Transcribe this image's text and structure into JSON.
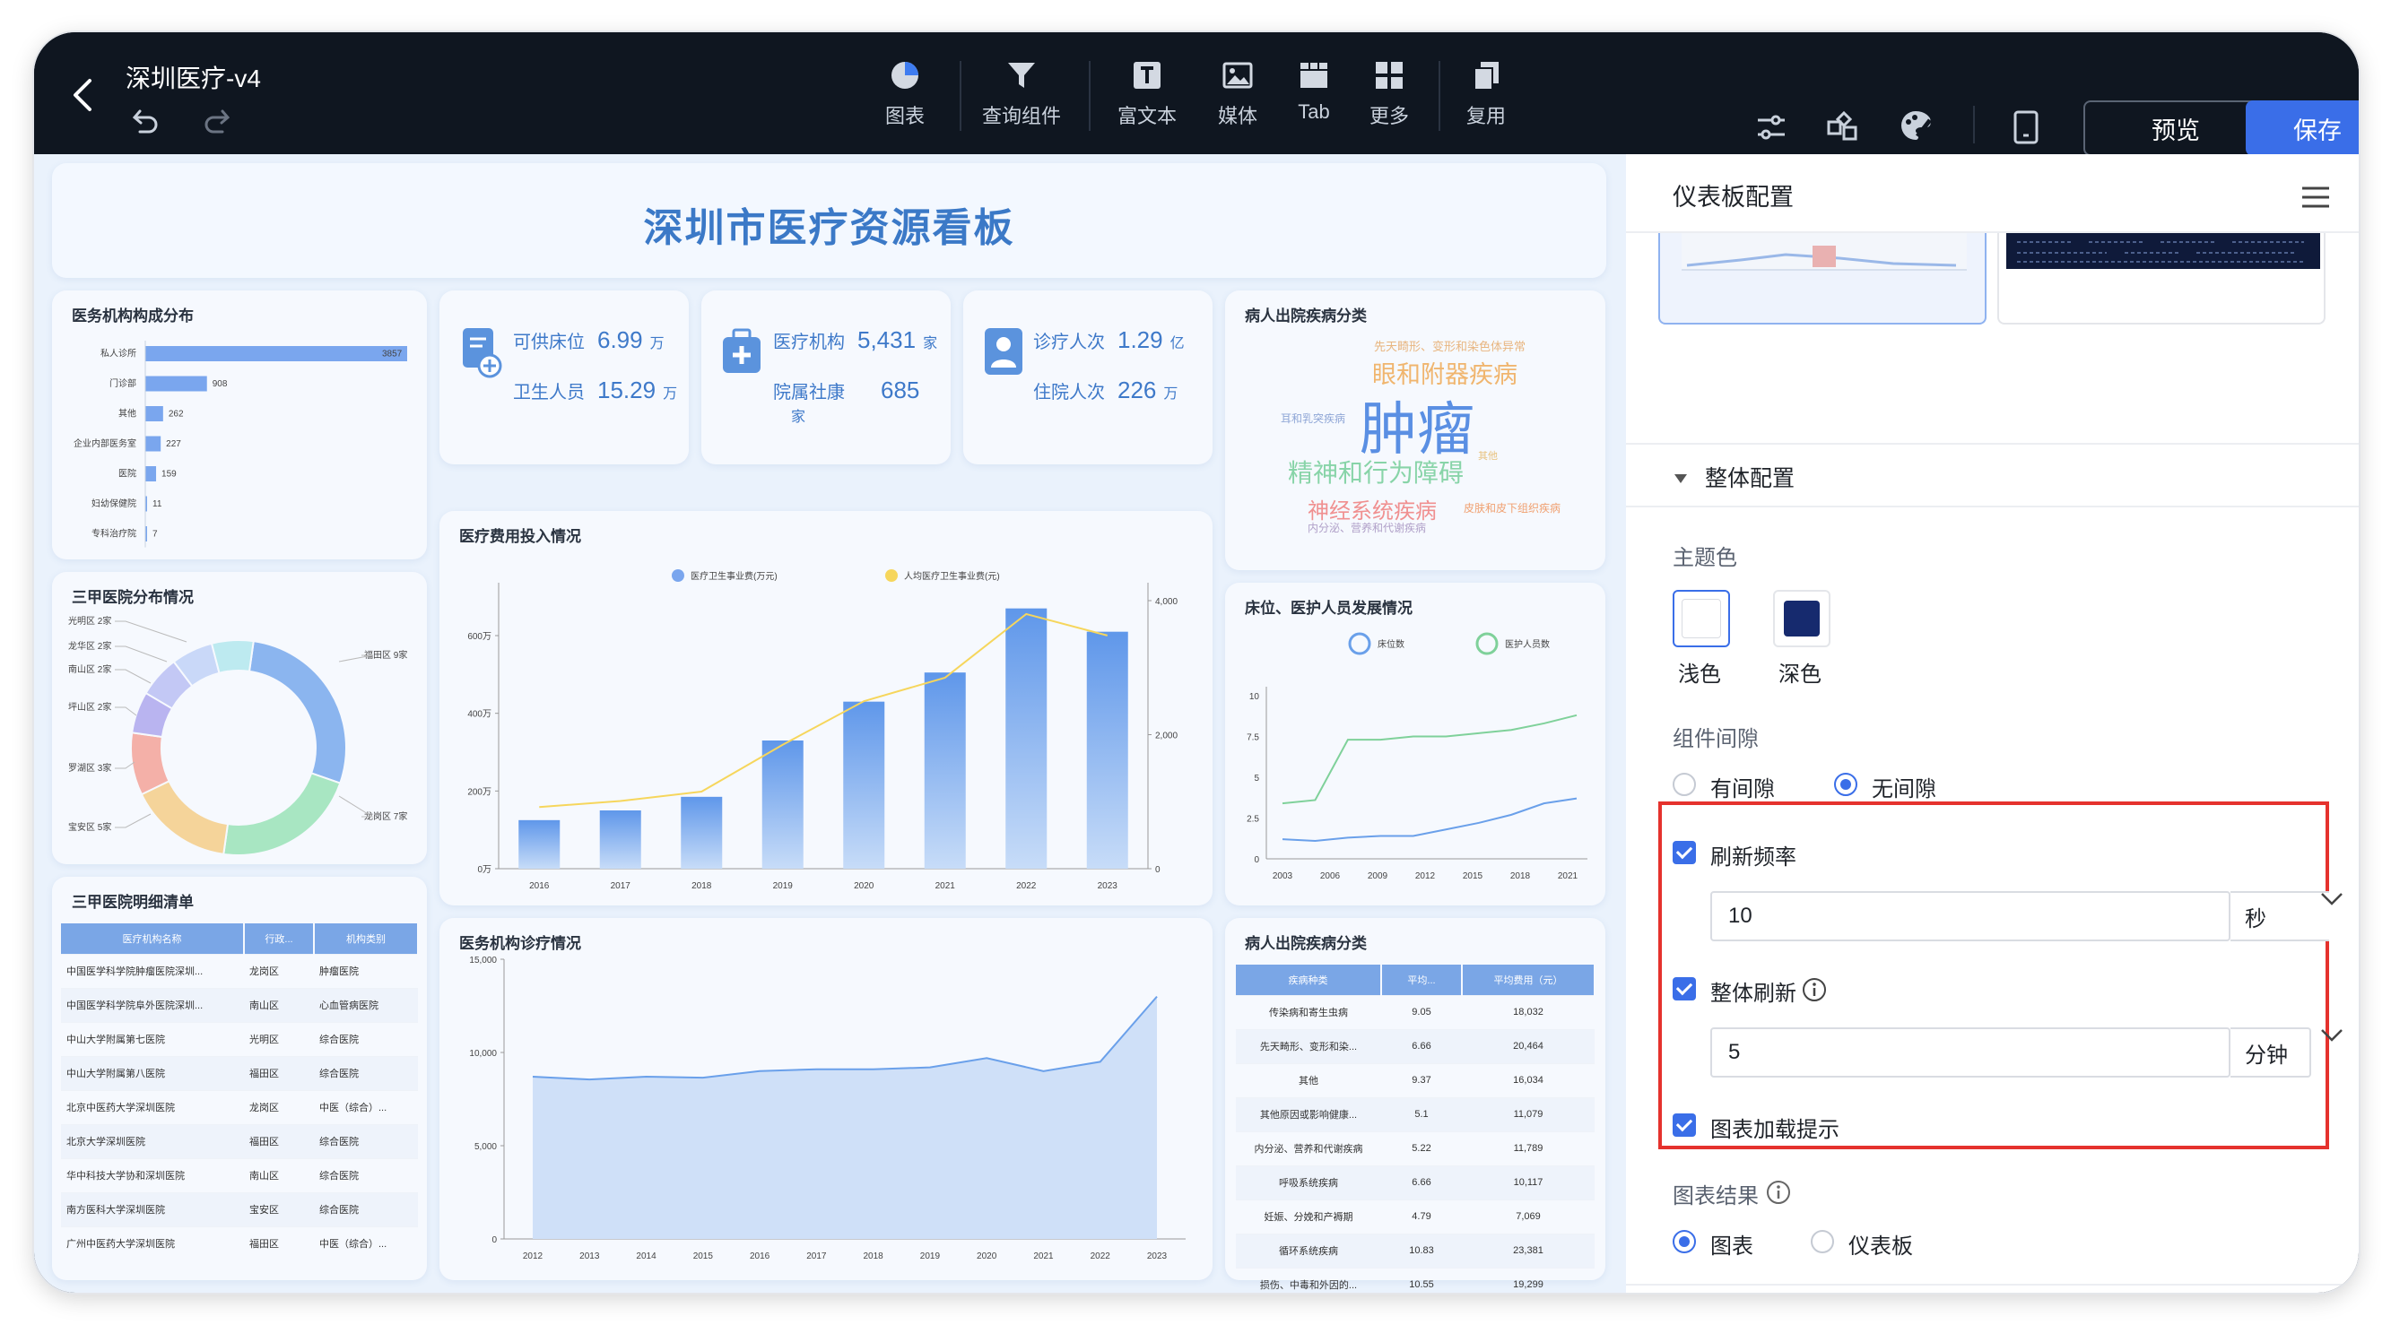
{
  "topbar": {
    "title": "深圳医疗-v4",
    "tools": [
      "图表",
      "查询组件",
      "富文本",
      "媒体",
      "Tab",
      "更多",
      "复用"
    ],
    "preview_label": "预览",
    "save_label": "保存"
  },
  "dashboard": {
    "title": "深圳市医疗资源看板",
    "org_dist": {
      "title": "医务机构构成分布",
      "rows": [
        {
          "label": "私人诊所",
          "value": 3857,
          "text": "3857"
        },
        {
          "label": "门诊部",
          "value": 908,
          "text": "908"
        },
        {
          "label": "其他",
          "value": 262,
          "text": "262"
        },
        {
          "label": "企业内部医务室",
          "value": 227,
          "text": "227"
        },
        {
          "label": "医院",
          "value": 159,
          "text": "159"
        },
        {
          "label": "妇幼保健院",
          "value": 11,
          "text": "11"
        },
        {
          "label": "专科治疗院",
          "value": 7,
          "text": "7"
        }
      ]
    },
    "kpi1": {
      "a_label": "可供床位",
      "a_value": "6.99",
      "a_unit": "万",
      "b_label": "卫生人员",
      "b_value": "15.29",
      "b_unit": "万"
    },
    "kpi2": {
      "a_label": "医疗机构",
      "a_value": "5,431",
      "a_unit": "家",
      "b_label": "院属社康",
      "b_value": "685",
      "b_unit": "家"
    },
    "kpi3": {
      "a_label": "诊疗人次",
      "a_value": "1.29",
      "a_unit": "亿",
      "b_label": "住院人次",
      "b_value": "226",
      "b_unit": "万"
    },
    "wordcloud": {
      "title": "病人出院疾病分类",
      "words": [
        "先天畸形、变形和染色体异常",
        "眼和附器疾病",
        "耳和乳突疾病",
        "肿瘤",
        "精神和行为障碍",
        "其他",
        "神经系统疾病",
        "皮肤和皮下组织疾病",
        "内分泌、营养和代谢疾病"
      ]
    },
    "tertiary_dist": {
      "title": "三甲医院分布情况",
      "labels": [
        "光明区 2家",
        "龙华区 2家",
        "南山区 2家",
        "坪山区 2家",
        "罗湖区 3家",
        "宝安区 5家",
        "福田区 9家",
        "龙岗区 7家"
      ]
    },
    "cost": {
      "title": "医疗费用投入情况"
    },
    "beds": {
      "title": "床位、医护人员发展情况"
    },
    "hosp_list": {
      "title": "三甲医院明细清单",
      "columns": [
        "医疗机构名称",
        "行政...",
        "机构类别"
      ],
      "rows": [
        [
          "中国医学科学院肿瘤医院深圳...",
          "龙岗区",
          "肿瘤医院"
        ],
        [
          "中国医学科学院阜外医院深圳...",
          "南山区",
          "心血管病医院"
        ],
        [
          "中山大学附属第七医院",
          "光明区",
          "综合医院"
        ],
        [
          "中山大学附属第八医院",
          "福田区",
          "综合医院"
        ],
        [
          "北京中医药大学深圳医院",
          "龙岗区",
          "中医（综合）..."
        ],
        [
          "北京大学深圳医院",
          "福田区",
          "综合医院"
        ],
        [
          "华中科技大学协和深圳医院",
          "南山区",
          "综合医院"
        ],
        [
          "南方医科大学深圳医院",
          "宝安区",
          "综合医院"
        ],
        [
          "广州中医药大学深圳医院",
          "福田区",
          "中医（综合）..."
        ]
      ]
    },
    "visits": {
      "title": "医务机构诊疗情况"
    },
    "disease_table": {
      "title": "病人出院疾病分类",
      "columns": [
        "疾病种类",
        "平均...",
        "平均费用（元）"
      ],
      "rows": [
        [
          "传染病和寄生虫病",
          "9.05",
          "18,032"
        ],
        [
          "先天畸形、变形和染...",
          "6.66",
          "20,464"
        ],
        [
          "其他",
          "9.37",
          "16,034"
        ],
        [
          "其他原因或影响健康...",
          "5.1",
          "11,079"
        ],
        [
          "内分泌、营养和代谢疾病",
          "5.22",
          "11,789"
        ],
        [
          "呼吸系统疾病",
          "6.66",
          "10,117"
        ],
        [
          "妊娠、分娩和产褥期",
          "4.79",
          "7,069"
        ],
        [
          "循环系统疾病",
          "10.83",
          "23,381"
        ],
        [
          "损伤、中毒和外因的...",
          "10.55",
          "19,299"
        ]
      ]
    }
  },
  "chart_data": [
    {
      "type": "bar",
      "title": "医务机构构成分布",
      "categories": [
        "私人诊所",
        "门诊部",
        "其他",
        "企业内部医务室",
        "医院",
        "妇幼保健院",
        "专科治疗院"
      ],
      "values": [
        3857,
        908,
        262,
        227,
        159,
        11,
        7
      ]
    },
    {
      "type": "pie",
      "title": "三甲医院分布情况",
      "categories": [
        "福田区",
        "龙岗区",
        "宝安区",
        "罗湖区",
        "坪山区",
        "南山区",
        "龙华区",
        "光明区"
      ],
      "values": [
        9,
        7,
        5,
        3,
        2,
        2,
        2,
        2
      ]
    },
    {
      "type": "bar",
      "title": "医疗费用投入情况",
      "categories": [
        "2016",
        "2017",
        "2018",
        "2019",
        "2020",
        "2021",
        "2022",
        "2023"
      ],
      "series": [
        {
          "name": "医疗卫生事业费(万元)",
          "type": "bar",
          "values": [
            125,
            150,
            185,
            330,
            430,
            505,
            670,
            610
          ]
        },
        {
          "name": "人均医疗卫生事业费(元)",
          "type": "line",
          "axis": "right",
          "values": [
            920,
            1010,
            1150,
            1850,
            2500,
            2850,
            3800,
            3480
          ]
        }
      ],
      "y_ticks_left": [
        "0万",
        "200万",
        "400万",
        "600万"
      ],
      "ylim_left": [
        0,
        690
      ],
      "y_ticks_right": [
        "0",
        "2,000",
        "4,000"
      ],
      "ylim_right": [
        0,
        4000
      ],
      "legend": "top"
    },
    {
      "type": "line",
      "title": "床位、医护人员发展情况",
      "x": [
        "2003",
        "2006",
        "2009",
        "2012",
        "2015",
        "2018",
        "2021"
      ],
      "series": [
        {
          "name": "床位数",
          "values": [
            3.4,
            3.6,
            7.3,
            7.3,
            7.5,
            7.5,
            7.7,
            7.9,
            8.3,
            8.8
          ]
        },
        {
          "name": "医护人员数",
          "values": [
            1.2,
            1.1,
            1.3,
            1.4,
            1.4,
            1.8,
            2.2,
            2.7,
            3.4,
            3.7
          ]
        }
      ],
      "y_ticks": [
        "0",
        "2.5",
        "5",
        "7.5",
        "10"
      ],
      "ylim": [
        0,
        10
      ],
      "legend": "top"
    },
    {
      "type": "area",
      "title": "医务机构诊疗情况",
      "x": [
        "2012",
        "2013",
        "2014",
        "2015",
        "2016",
        "2017",
        "2018",
        "2019",
        "2020",
        "2021",
        "2022",
        "2023"
      ],
      "values": [
        8700,
        8550,
        8700,
        8650,
        9000,
        9100,
        9100,
        9200,
        9700,
        9000,
        9500,
        13000
      ],
      "y_ticks": [
        "0",
        "5,000",
        "10,000",
        "15,000"
      ],
      "ylim": [
        0,
        15000
      ]
    }
  ],
  "panel": {
    "title": "仪表板配置",
    "section_overall": "整体配置",
    "theme_label": "主题色",
    "theme_light": "浅色",
    "theme_dark": "深色",
    "color_light": "#ffffff",
    "color_dark": "#162a6e",
    "gap_label": "组件间隙",
    "gap_with": "有间隙",
    "gap_none": "无间隙",
    "refresh_label": "刷新频率",
    "refresh_value": "10",
    "refresh_unit": "秒",
    "global_refresh_label": "整体刷新",
    "global_refresh_value": "5",
    "global_refresh_unit": "分钟",
    "loading_tip_label": "图表加载提示",
    "result_label": "图表结果",
    "result_chart": "图表",
    "result_dashboard": "仪表板",
    "highlight_color": "#e5322d",
    "accent_color": "#3a6ee8"
  }
}
